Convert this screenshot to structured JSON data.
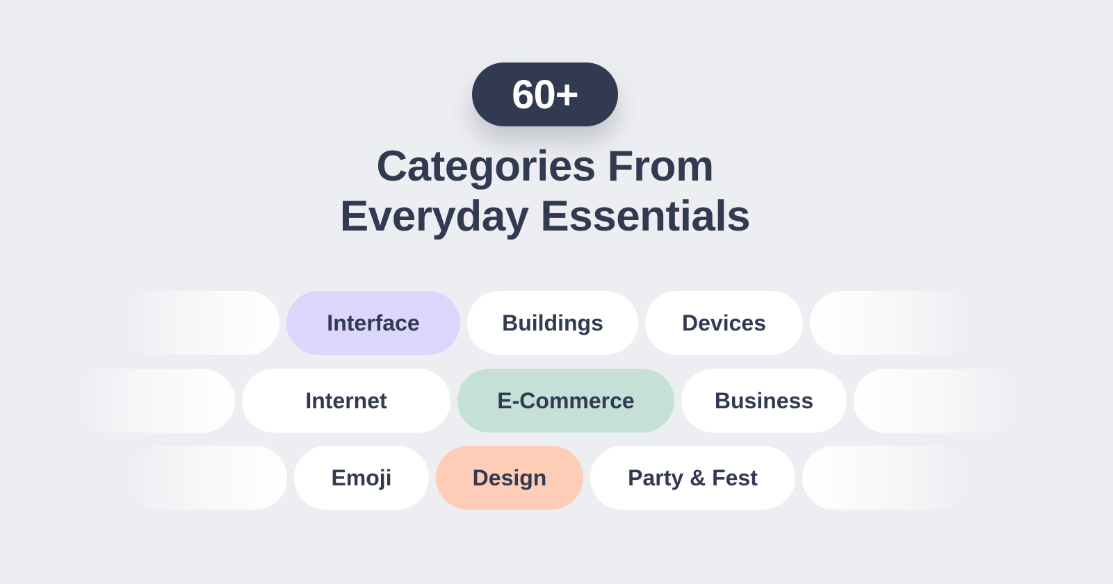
{
  "badge": {
    "label": "60+"
  },
  "heading": {
    "line1": "Categories From",
    "line2": "Everyday Essentials"
  },
  "colors": {
    "background": "#edeef2",
    "text": "#323a52",
    "badge_bg": "#323a52",
    "pill_default": "#ffffff",
    "pill_purple": "#dcd6fc",
    "pill_green": "#c4e0d7",
    "pill_peach": "#fdcdb8"
  },
  "rows": [
    {
      "pills": [
        {
          "label": "Interface",
          "style": "purple"
        },
        {
          "label": "Buildings",
          "style": "white"
        },
        {
          "label": "Devices",
          "style": "white"
        }
      ]
    },
    {
      "pills": [
        {
          "label": "Internet",
          "style": "white"
        },
        {
          "label": "E-Commerce",
          "style": "green"
        },
        {
          "label": "Business",
          "style": "white"
        }
      ]
    },
    {
      "pills": [
        {
          "label": "Emoji",
          "style": "white"
        },
        {
          "label": "Design",
          "style": "peach"
        },
        {
          "label": "Party & Fest",
          "style": "white"
        }
      ]
    }
  ]
}
